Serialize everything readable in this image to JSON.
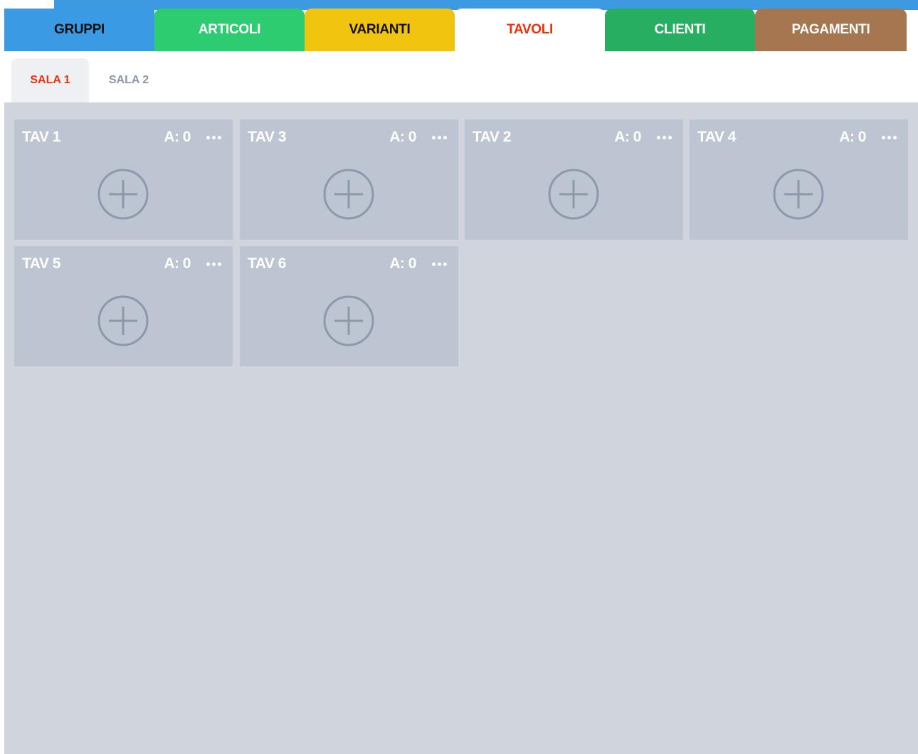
{
  "main_tabs": [
    {
      "label": "GRUPPI",
      "bg": "#3a9ae3",
      "fg": "#111111"
    },
    {
      "label": "ARTICOLI",
      "bg": "#2ecc71",
      "fg": "#ffffff"
    },
    {
      "label": "VARIANTI",
      "bg": "#f1c40f",
      "fg": "#111111"
    },
    {
      "label": "TAVOLI",
      "bg": "#ffffff",
      "fg": "#f0300b"
    },
    {
      "label": "CLIENTI",
      "bg": "#27ae60",
      "fg": "#ffffff"
    },
    {
      "label": "PAGAMENTI",
      "bg": "#a67650",
      "fg": "#ffffff"
    }
  ],
  "active_main_tab": "TAVOLI",
  "rooms": [
    {
      "label": "SALA 1",
      "active": true
    },
    {
      "label": "SALA 2",
      "active": false
    }
  ],
  "tables": [
    {
      "name": "TAV 1",
      "count": "A: 0"
    },
    {
      "name": "TAV 3",
      "count": "A: 0"
    },
    {
      "name": "TAV 2",
      "count": "A: 0"
    },
    {
      "name": "TAV 4",
      "count": "A: 0"
    },
    {
      "name": "TAV 5",
      "count": "A: 0"
    },
    {
      "name": "TAV 6",
      "count": "A: 0"
    }
  ],
  "icons": {
    "more": "more-dots-icon",
    "add": "plus-circle-icon"
  },
  "colors": {
    "floor_bg": "#d0d4dd",
    "card_bg": "#bec5d2",
    "add_icon": "#8e98ab",
    "active_room": "#f0300b",
    "inactive_room": "#8b95a7"
  }
}
